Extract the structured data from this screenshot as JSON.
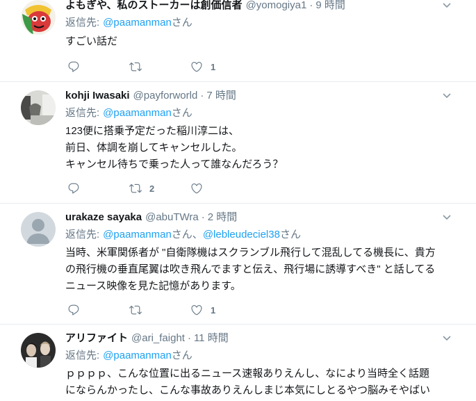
{
  "colors": {
    "text": "#14171a",
    "secondary": "#657786",
    "link": "#1da1f2",
    "divider": "#e6ecf0",
    "background": "#ffffff"
  },
  "icons": {
    "reply": "reply-icon",
    "retweet": "retweet-icon",
    "like": "heart-icon",
    "menu": "chevron-down-icon"
  },
  "tweets": [
    {
      "name": "よもぎや、私のストーカーは創価信者",
      "handle": "@yomogiya1",
      "separator": "·",
      "time": "9 時間",
      "reply_label": "返信先:",
      "mentions": [
        {
          "handle": "@paamanman",
          "suffix": "さん"
        }
      ],
      "lines": [
        "すごい話だ"
      ],
      "actions": {
        "like_count": "1"
      }
    },
    {
      "name": "kohji Iwasaki",
      "handle": "@payforworld",
      "separator": "·",
      "time": "7 時間",
      "reply_label": "返信先:",
      "mentions": [
        {
          "handle": "@paamanman",
          "suffix": "さん"
        }
      ],
      "lines": [
        "123便に搭乗予定だった稲川淳二は、",
        "前日、体調を崩してキャンセルした。",
        "キャンセル待ちで乗った人って誰なんだろう？"
      ],
      "actions": {
        "retweet_count": "2"
      }
    },
    {
      "name": "urakaze sayaka",
      "handle": "@abuTWra",
      "separator": "·",
      "time": "2 時間",
      "reply_label": "返信先:",
      "mentions": [
        {
          "handle": "@paamanman",
          "suffix": "さん、"
        },
        {
          "handle": "@lebleudeciel38",
          "suffix": "さん"
        }
      ],
      "lines": [
        "当時、米軍関係者が \"自衛隊機はスクランブル飛行して混乱してる機長に、貴方",
        "の飛行機の垂直尾翼は吹き飛んでますと伝え、飛行場に誘導すべき\" と話してる",
        "ニュース映像を見た記憶があります。"
      ],
      "actions": {
        "like_count": "1"
      }
    },
    {
      "name": "アリファイト",
      "handle": "@ari_faight",
      "separator": "·",
      "time": "11 時間",
      "reply_label": "返信先:",
      "mentions": [
        {
          "handle": "@paamanman",
          "suffix": "さん"
        }
      ],
      "lines": [
        "ｐｐｐｐ、こんな位置に出るニュース速報ありえんし、なにより当時全く話題",
        "にならんかったし、こんな事故ありえんしまじ本気にしとるやつ脳みそやばい"
      ]
    }
  ]
}
